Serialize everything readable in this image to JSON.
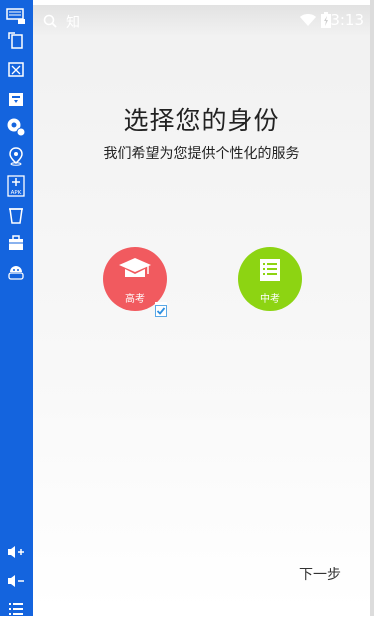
{
  "toolbar": {
    "icons": [
      "keyboard-icon",
      "rotate-icon",
      "screenshot-icon",
      "install-icon",
      "location-settings-icon",
      "location-icon",
      "apk-icon",
      "delete-icon",
      "toolbox-icon",
      "android-icon",
      "volume-up-icon",
      "volume-down-icon",
      "menu-icon"
    ],
    "apk_label": "APK",
    "accent": "#1464de"
  },
  "status_bar": {
    "search_text": "知",
    "time": "3:13"
  },
  "main": {
    "title": "选择您的身份",
    "subtitle": "我们希望为您提供个性化的服务",
    "options": [
      {
        "label": "高考",
        "color": "#f15a5f",
        "icon": "graduation-cap-icon",
        "selected": true
      },
      {
        "label": "中考",
        "color": "#8dd412",
        "icon": "notebook-icon",
        "selected": false
      }
    ],
    "next_label": "下一步"
  }
}
